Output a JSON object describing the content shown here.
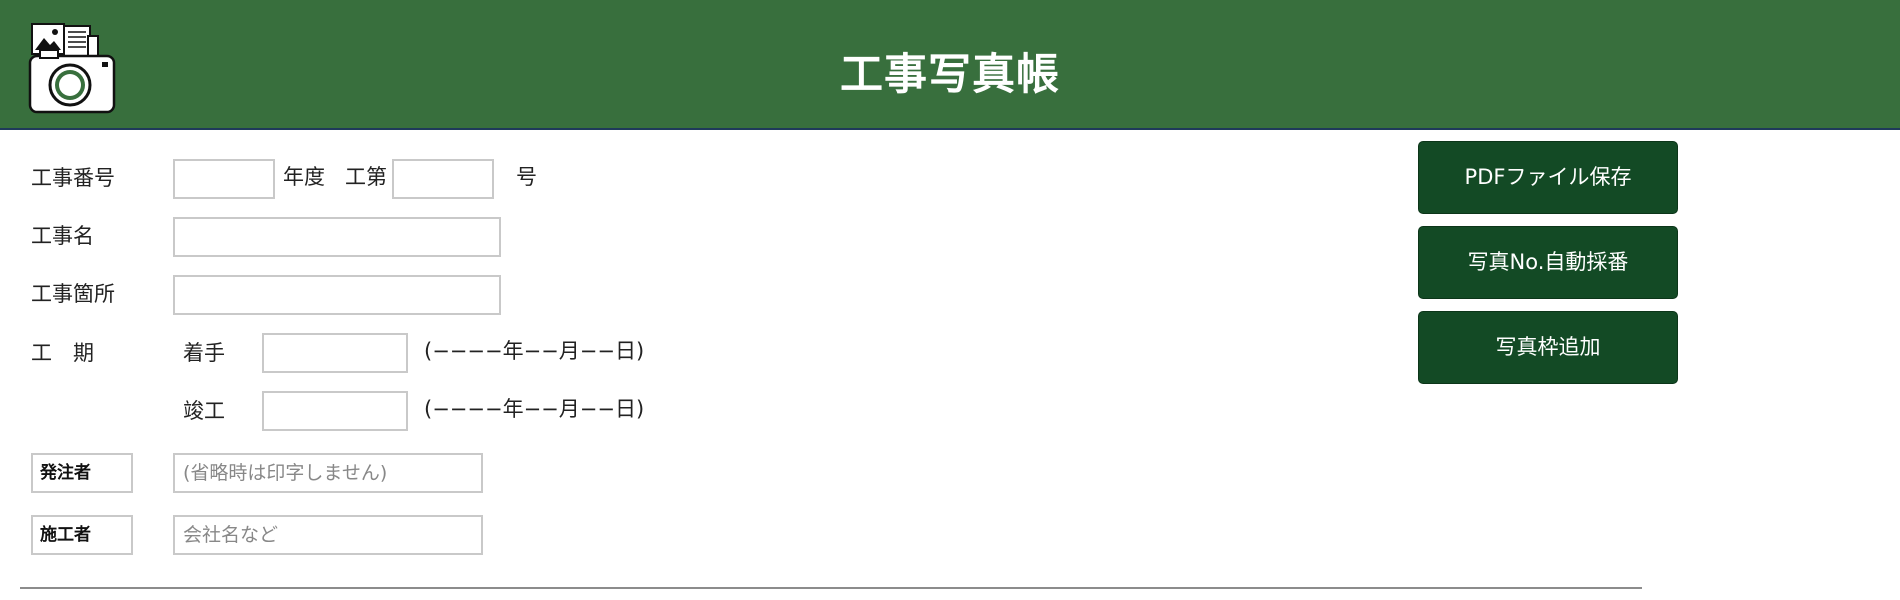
{
  "header": {
    "title": "工事写真帳",
    "logo_icon": "camera-photo-album-icon",
    "background_color": "#386f3d"
  },
  "form": {
    "project_number": {
      "label": "工事番号",
      "year_value": "",
      "year_suffix": "年度",
      "prefix": "工第",
      "number_value": "",
      "suffix": "号"
    },
    "project_name": {
      "label": "工事名",
      "value": ""
    },
    "project_location": {
      "label": "工事箇所",
      "value": ""
    },
    "period": {
      "label": "工　期",
      "start_label": "着手",
      "start_value": "",
      "start_format": "(−−−−年−−月−−日)",
      "end_label": "竣工",
      "end_value": "",
      "end_format": "(−−−−年−−月−−日)"
    },
    "client": {
      "label": "発注者",
      "placeholder": "(省略時は印字しません)",
      "value": ""
    },
    "contractor": {
      "label": "施工者",
      "placeholder": "会社名など",
      "value": ""
    }
  },
  "actions": {
    "save_pdf": "PDFファイル保存",
    "auto_number": "写真No.自動採番",
    "add_frame": "写真枠追加",
    "button_color": "#134a25"
  }
}
